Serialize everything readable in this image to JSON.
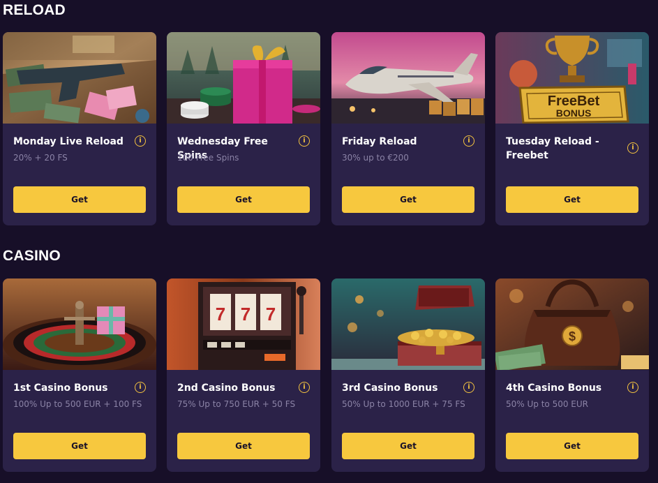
{
  "sections": [
    {
      "title": "RELOAD",
      "cards": [
        {
          "title": "Monday Live Reload",
          "subtitle": "20% + 20 FS",
          "button": "Get",
          "info": "i",
          "image": "gun-and-cards-image"
        },
        {
          "title": "Wednesday Free Spins",
          "subtitle": "100 Free Spins",
          "button": "Get",
          "info": "i",
          "image": "gift-box-and-chips-image"
        },
        {
          "title": "Friday Reload",
          "subtitle": "30% up to €200",
          "button": "Get",
          "info": "i",
          "image": "private-jet-image"
        },
        {
          "title": "Tuesday Reload - Freebet",
          "subtitle": "",
          "button": "Get",
          "info": "i",
          "image": "freebet-bonus-trophy-image",
          "image_text_1": "FreeBet",
          "image_text_2": "BONUS"
        }
      ]
    },
    {
      "title": "CASINO",
      "cards": [
        {
          "title": "1st Casino Bonus",
          "subtitle": "100% Up to 500 EUR + 100 FS",
          "button": "Get",
          "info": "i",
          "image": "roulette-wheel-image"
        },
        {
          "title": "2nd Casino Bonus",
          "subtitle": "75% Up to 750 EUR + 50 FS",
          "button": "Get",
          "info": "i",
          "image": "slot-machine-image",
          "image_text_1": "7"
        },
        {
          "title": "3rd Casino Bonus",
          "subtitle": "50% Up to 1000 EUR + 75 FS",
          "button": "Get",
          "info": "i",
          "image": "treasure-chest-image"
        },
        {
          "title": "4th Casino Bonus",
          "subtitle": "50% Up to 500 EUR",
          "button": "Get",
          "info": "i",
          "image": "money-bag-image",
          "image_text_1": "$"
        }
      ]
    }
  ],
  "colors": {
    "background": "#170f28",
    "card": "#2b2248",
    "accent": "#f7c83e",
    "muted_text": "#8b83a6"
  }
}
